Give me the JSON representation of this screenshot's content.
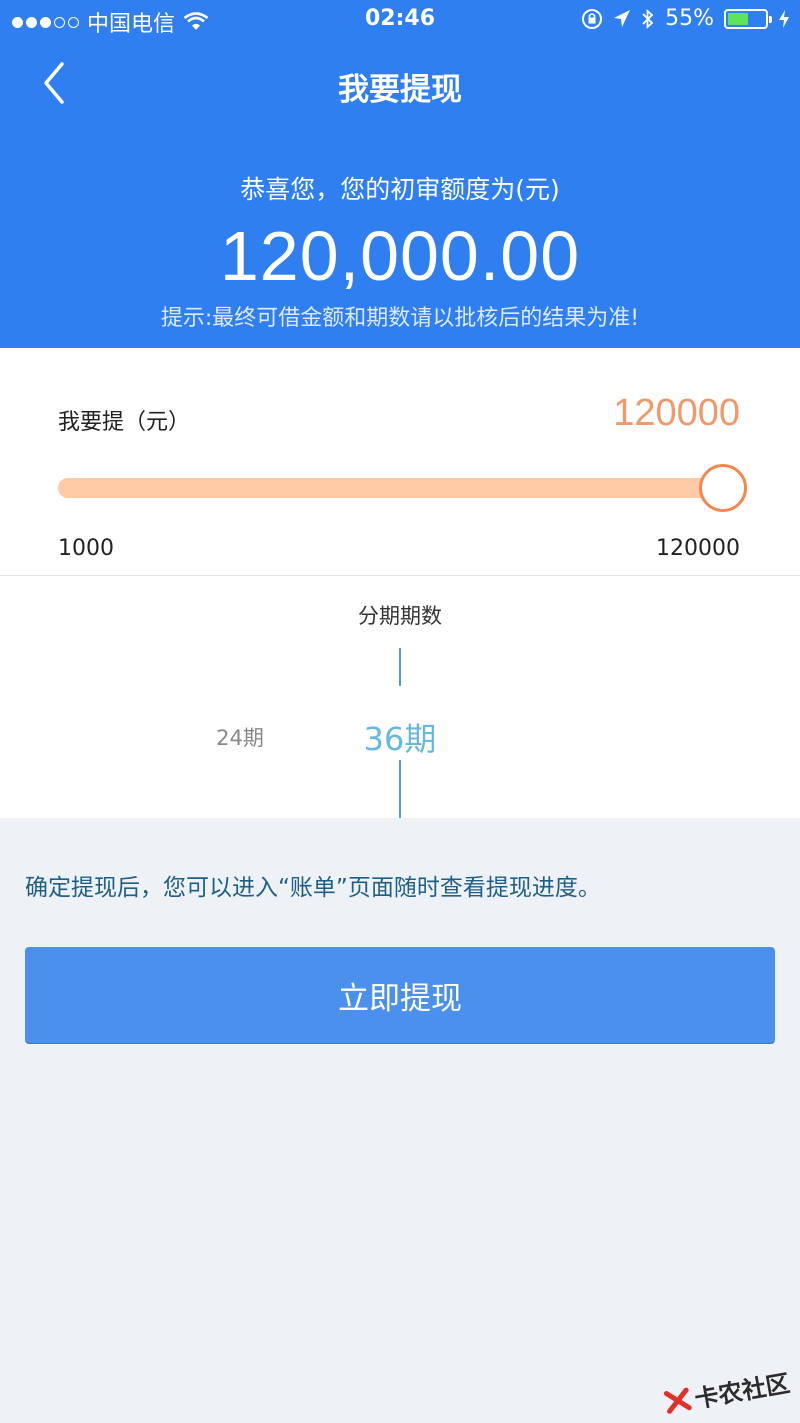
{
  "status_bar": {
    "carrier": "中国电信",
    "time": "02:46",
    "battery_percent": "55%",
    "battery_level": 0.55,
    "battery_color": "#5fe35a"
  },
  "header": {
    "title": "我要提现",
    "congrats": "恭喜您，您的初审额度为(元)",
    "amount": "120,000.00",
    "hint": "提示:最终可借金额和期数请以批核后的结果为准!"
  },
  "withdraw": {
    "label": "我要提（元）",
    "value": "120000",
    "min": "1000",
    "max": "120000",
    "slider_fraction": 1.0
  },
  "period": {
    "title": "分期期数",
    "option_prev": "24期",
    "selected": "36期"
  },
  "notice": "确定提现后，您可以进入“账单”页面随时查看提现进度。",
  "submit_label": "立即提现",
  "watermark": "卡农社区",
  "colors": {
    "brand_blue": "#2f7ff0",
    "button_blue": "#4a90ec",
    "accent_orange": "#f09a6c",
    "period_blue": "#68b8df"
  }
}
